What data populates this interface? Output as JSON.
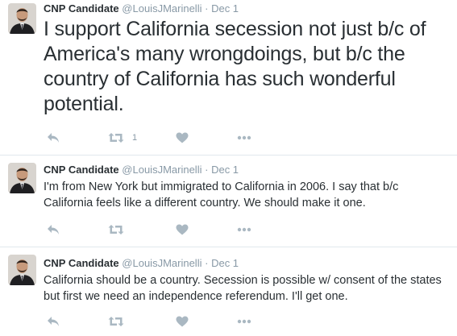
{
  "colors": {
    "text": "#292f33",
    "muted": "#8899a6",
    "icon": "#aab8c2",
    "divider": "#e1e8ed"
  },
  "tweets": [
    {
      "name": "CNP Candidate",
      "handle": "@LouisJMarinelli",
      "separator": "·",
      "date": "Dec 1",
      "text": "I support California secession not just b/c of America's many wrongdoings, but b/c the country of California has such wonderful potential.",
      "retweet_count": "1",
      "icons": [
        "reply-icon",
        "retweet-icon",
        "like-icon",
        "more-icon"
      ]
    },
    {
      "name": "CNP Candidate",
      "handle": "@LouisJMarinelli",
      "separator": "·",
      "date": "Dec 1",
      "text": "I'm from New York but immigrated to California in 2006. I say that b/c California feels like a different country. We should make it one.",
      "retweet_count": "",
      "icons": [
        "reply-icon",
        "retweet-icon",
        "like-icon",
        "more-icon"
      ]
    },
    {
      "name": "CNP Candidate",
      "handle": "@LouisJMarinelli",
      "separator": "·",
      "date": "Dec 1",
      "text": "California should be a country. Secession is possible w/ consent of the states but first we need an independence referendum. I'll get one.",
      "retweet_count": "",
      "icons": [
        "reply-icon",
        "retweet-icon",
        "like-icon",
        "more-icon"
      ]
    }
  ]
}
